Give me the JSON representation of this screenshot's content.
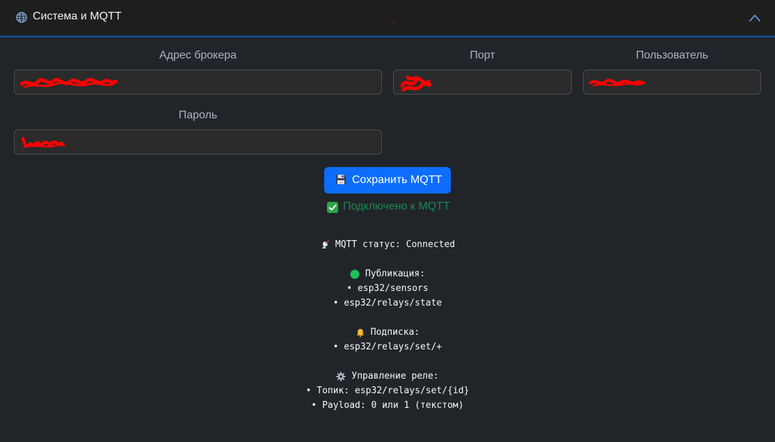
{
  "header": {
    "title": "Система и MQTT",
    "accent_color": "#1c4a86"
  },
  "form": {
    "broker": {
      "label": "Адрес брокера",
      "value": ""
    },
    "port": {
      "label": "Порт",
      "value": ""
    },
    "user": {
      "label": "Пользователь",
      "value": ""
    },
    "password": {
      "label": "Пароль",
      "value": ""
    }
  },
  "save_button": {
    "label": "Сохранить MQTT",
    "color": "#0d6efd",
    "icon": "floppy-disk-icon"
  },
  "connection_status": {
    "text": "Подключено к MQTT",
    "color": "#198754",
    "icon": "check-box-icon"
  },
  "info": {
    "status_line": "MQTT статус: Connected",
    "publish_heading": "Публикация:",
    "publish_topics": [
      "• esp32/sensors",
      "• esp32/relays/state"
    ],
    "subscribe_heading": "Подписка:",
    "subscribe_topics": [
      "• esp32/relays/set/+"
    ],
    "control_heading": "Управление реле:",
    "control_items": [
      "• Топик: esp32/relays/set/{id}",
      "• Payload: 0 или 1 (текстом)"
    ],
    "icons": {
      "status": "satellite-antenna-icon",
      "publish": "green-circle-icon",
      "subscribe": "bell-icon",
      "control": "gear-icon"
    }
  }
}
